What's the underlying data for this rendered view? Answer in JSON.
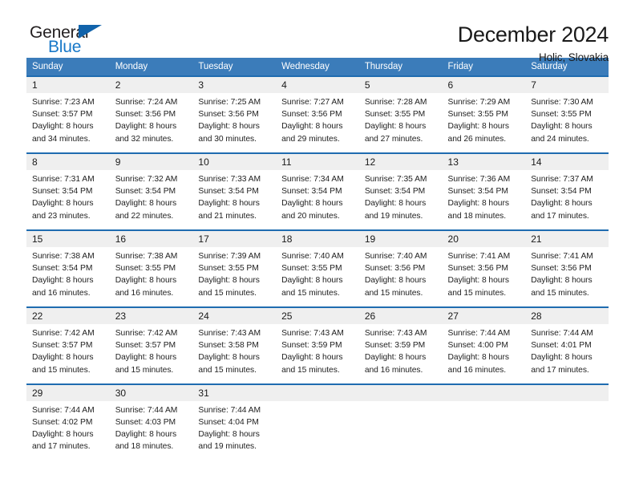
{
  "brand": {
    "name_part1": "General",
    "name_part2": "Blue",
    "triangle_color": "#1163ab",
    "blue_color": "#1878c8"
  },
  "header": {
    "title": "December 2024",
    "location": "Holic, Slovakia"
  },
  "theme": {
    "header_blue": "#3b7cba",
    "row_border_blue": "#1f6cb0",
    "daynum_gray": "#efefef"
  },
  "weekdays": [
    "Sunday",
    "Monday",
    "Tuesday",
    "Wednesday",
    "Thursday",
    "Friday",
    "Saturday"
  ],
  "weeks": [
    [
      {
        "day": "1",
        "sunrise": "Sunrise: 7:23 AM",
        "sunset": "Sunset: 3:57 PM",
        "daylight1": "Daylight: 8 hours",
        "daylight2": "and 34 minutes."
      },
      {
        "day": "2",
        "sunrise": "Sunrise: 7:24 AM",
        "sunset": "Sunset: 3:56 PM",
        "daylight1": "Daylight: 8 hours",
        "daylight2": "and 32 minutes."
      },
      {
        "day": "3",
        "sunrise": "Sunrise: 7:25 AM",
        "sunset": "Sunset: 3:56 PM",
        "daylight1": "Daylight: 8 hours",
        "daylight2": "and 30 minutes."
      },
      {
        "day": "4",
        "sunrise": "Sunrise: 7:27 AM",
        "sunset": "Sunset: 3:56 PM",
        "daylight1": "Daylight: 8 hours",
        "daylight2": "and 29 minutes."
      },
      {
        "day": "5",
        "sunrise": "Sunrise: 7:28 AM",
        "sunset": "Sunset: 3:55 PM",
        "daylight1": "Daylight: 8 hours",
        "daylight2": "and 27 minutes."
      },
      {
        "day": "6",
        "sunrise": "Sunrise: 7:29 AM",
        "sunset": "Sunset: 3:55 PM",
        "daylight1": "Daylight: 8 hours",
        "daylight2": "and 26 minutes."
      },
      {
        "day": "7",
        "sunrise": "Sunrise: 7:30 AM",
        "sunset": "Sunset: 3:55 PM",
        "daylight1": "Daylight: 8 hours",
        "daylight2": "and 24 minutes."
      }
    ],
    [
      {
        "day": "8",
        "sunrise": "Sunrise: 7:31 AM",
        "sunset": "Sunset: 3:54 PM",
        "daylight1": "Daylight: 8 hours",
        "daylight2": "and 23 minutes."
      },
      {
        "day": "9",
        "sunrise": "Sunrise: 7:32 AM",
        "sunset": "Sunset: 3:54 PM",
        "daylight1": "Daylight: 8 hours",
        "daylight2": "and 22 minutes."
      },
      {
        "day": "10",
        "sunrise": "Sunrise: 7:33 AM",
        "sunset": "Sunset: 3:54 PM",
        "daylight1": "Daylight: 8 hours",
        "daylight2": "and 21 minutes."
      },
      {
        "day": "11",
        "sunrise": "Sunrise: 7:34 AM",
        "sunset": "Sunset: 3:54 PM",
        "daylight1": "Daylight: 8 hours",
        "daylight2": "and 20 minutes."
      },
      {
        "day": "12",
        "sunrise": "Sunrise: 7:35 AM",
        "sunset": "Sunset: 3:54 PM",
        "daylight1": "Daylight: 8 hours",
        "daylight2": "and 19 minutes."
      },
      {
        "day": "13",
        "sunrise": "Sunrise: 7:36 AM",
        "sunset": "Sunset: 3:54 PM",
        "daylight1": "Daylight: 8 hours",
        "daylight2": "and 18 minutes."
      },
      {
        "day": "14",
        "sunrise": "Sunrise: 7:37 AM",
        "sunset": "Sunset: 3:54 PM",
        "daylight1": "Daylight: 8 hours",
        "daylight2": "and 17 minutes."
      }
    ],
    [
      {
        "day": "15",
        "sunrise": "Sunrise: 7:38 AM",
        "sunset": "Sunset: 3:54 PM",
        "daylight1": "Daylight: 8 hours",
        "daylight2": "and 16 minutes."
      },
      {
        "day": "16",
        "sunrise": "Sunrise: 7:38 AM",
        "sunset": "Sunset: 3:55 PM",
        "daylight1": "Daylight: 8 hours",
        "daylight2": "and 16 minutes."
      },
      {
        "day": "17",
        "sunrise": "Sunrise: 7:39 AM",
        "sunset": "Sunset: 3:55 PM",
        "daylight1": "Daylight: 8 hours",
        "daylight2": "and 15 minutes."
      },
      {
        "day": "18",
        "sunrise": "Sunrise: 7:40 AM",
        "sunset": "Sunset: 3:55 PM",
        "daylight1": "Daylight: 8 hours",
        "daylight2": "and 15 minutes."
      },
      {
        "day": "19",
        "sunrise": "Sunrise: 7:40 AM",
        "sunset": "Sunset: 3:56 PM",
        "daylight1": "Daylight: 8 hours",
        "daylight2": "and 15 minutes."
      },
      {
        "day": "20",
        "sunrise": "Sunrise: 7:41 AM",
        "sunset": "Sunset: 3:56 PM",
        "daylight1": "Daylight: 8 hours",
        "daylight2": "and 15 minutes."
      },
      {
        "day": "21",
        "sunrise": "Sunrise: 7:41 AM",
        "sunset": "Sunset: 3:56 PM",
        "daylight1": "Daylight: 8 hours",
        "daylight2": "and 15 minutes."
      }
    ],
    [
      {
        "day": "22",
        "sunrise": "Sunrise: 7:42 AM",
        "sunset": "Sunset: 3:57 PM",
        "daylight1": "Daylight: 8 hours",
        "daylight2": "and 15 minutes."
      },
      {
        "day": "23",
        "sunrise": "Sunrise: 7:42 AM",
        "sunset": "Sunset: 3:57 PM",
        "daylight1": "Daylight: 8 hours",
        "daylight2": "and 15 minutes."
      },
      {
        "day": "24",
        "sunrise": "Sunrise: 7:43 AM",
        "sunset": "Sunset: 3:58 PM",
        "daylight1": "Daylight: 8 hours",
        "daylight2": "and 15 minutes."
      },
      {
        "day": "25",
        "sunrise": "Sunrise: 7:43 AM",
        "sunset": "Sunset: 3:59 PM",
        "daylight1": "Daylight: 8 hours",
        "daylight2": "and 15 minutes."
      },
      {
        "day": "26",
        "sunrise": "Sunrise: 7:43 AM",
        "sunset": "Sunset: 3:59 PM",
        "daylight1": "Daylight: 8 hours",
        "daylight2": "and 16 minutes."
      },
      {
        "day": "27",
        "sunrise": "Sunrise: 7:44 AM",
        "sunset": "Sunset: 4:00 PM",
        "daylight1": "Daylight: 8 hours",
        "daylight2": "and 16 minutes."
      },
      {
        "day": "28",
        "sunrise": "Sunrise: 7:44 AM",
        "sunset": "Sunset: 4:01 PM",
        "daylight1": "Daylight: 8 hours",
        "daylight2": "and 17 minutes."
      }
    ],
    [
      {
        "day": "29",
        "sunrise": "Sunrise: 7:44 AM",
        "sunset": "Sunset: 4:02 PM",
        "daylight1": "Daylight: 8 hours",
        "daylight2": "and 17 minutes."
      },
      {
        "day": "30",
        "sunrise": "Sunrise: 7:44 AM",
        "sunset": "Sunset: 4:03 PM",
        "daylight1": "Daylight: 8 hours",
        "daylight2": "and 18 minutes."
      },
      {
        "day": "31",
        "sunrise": "Sunrise: 7:44 AM",
        "sunset": "Sunset: 4:04 PM",
        "daylight1": "Daylight: 8 hours",
        "daylight2": "and 19 minutes."
      },
      {
        "day": "",
        "sunrise": "",
        "sunset": "",
        "daylight1": "",
        "daylight2": ""
      },
      {
        "day": "",
        "sunrise": "",
        "sunset": "",
        "daylight1": "",
        "daylight2": ""
      },
      {
        "day": "",
        "sunrise": "",
        "sunset": "",
        "daylight1": "",
        "daylight2": ""
      },
      {
        "day": "",
        "sunrise": "",
        "sunset": "",
        "daylight1": "",
        "daylight2": ""
      }
    ]
  ]
}
